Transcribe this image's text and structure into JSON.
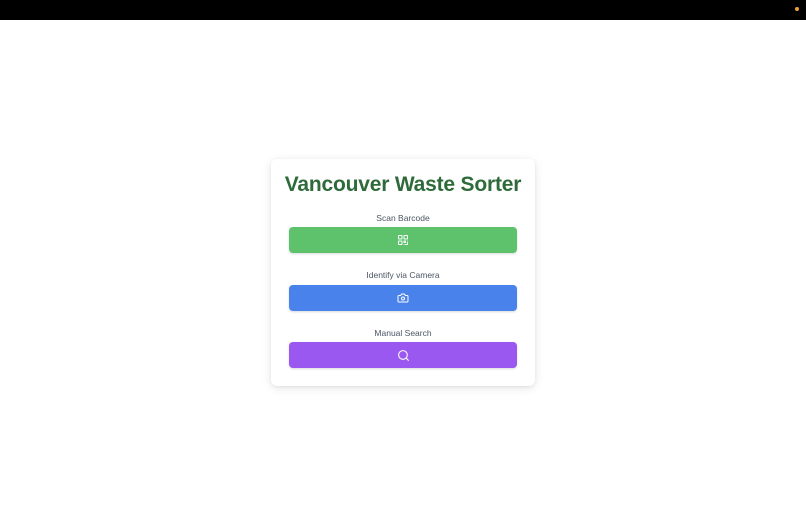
{
  "app": {
    "title": "Vancouver Waste Sorter"
  },
  "actions": [
    {
      "label": "Scan Barcode",
      "icon": "qr-code-icon",
      "color": "#5dc26b"
    },
    {
      "label": "Identify via Camera",
      "icon": "camera-icon",
      "color": "#4a82ec"
    },
    {
      "label": "Manual Search",
      "icon": "search-icon",
      "color": "#9a58f0"
    }
  ],
  "colors": {
    "title": "#2f6b3a",
    "top_bar": "#000000",
    "status_dot": "#f0a030"
  }
}
